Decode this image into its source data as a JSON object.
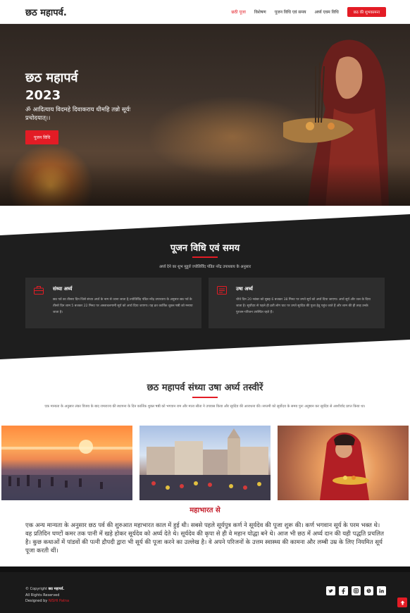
{
  "header": {
    "logo": "छठ महापर्व.",
    "nav": [
      "छठी पूजा",
      "विशेषण",
      "पूजन विधि एवं समय",
      "अर्घ्य एवम विधि"
    ],
    "cta": "छठ की शुभकामना"
  },
  "hero": {
    "title_line1": "छठ महापर्व",
    "title_line2": "2023",
    "mantra": "ॐ आदित्याय विदमहे दिवाकराय धीमहि तन्नो सूर्यः प्रचोदयात्।।",
    "button": "पूजन विधि"
  },
  "puja": {
    "title": "पूजन विधि एवं समय",
    "subtitle": "अर्घ्य देने का शुभ मुहूर्त ज्योतिर्विद पंडित नरेंद्र उपाध्याय के अनुसार",
    "cards": [
      {
        "title": "संध्या अर्घ्य",
        "text": "छठ पर्व का तीसरा दिन जिसे संध्या अर्घ्य के नाम से जाना जाता है,ज्योतिर्विद पंडित नरेंद्र उपाध्याय के अनुसार छठ पर्व के तीसरे दिन शाम 5 बजकर 22 मिनट पर अस्ताचलगामी सूर्य को अर्घ्य दिया जाएगा। यह व्रत कार्तिक शुक्ल षष्ठी को मनाया जाता है।"
      },
      {
        "title": "उषा अर्घ्य",
        "text": "चौथे दिन 20 नवंबर को सुबह 6 बजकर 38 मिनट पर उगते सूर्य को अर्घ्य दिया जाएगा। अर्घ्य सूर्य और जल के दिया जाता है। सूर्योदय से पहले ही व्रती लोग घाट पर उगते सूर्यदेव की पूजा हेतु पहुंच जाते हैं और शाम की ही तरह उनके पुरजन-परिजन उपस्थित रहते हैं।"
      }
    ]
  },
  "gallery": {
    "title": "छठ महापर्व संध्या उषा अर्घ्य तस्वीरें",
    "subtitle": "एक मान्यता के अनुसार लंका विजय के बाद रामराज्य की स्थापना के दिन कार्तिक शुक्ल षष्ठी को भगवान राम और माता सीता ने उपवास किया और सूर्यदेव की आराधना की। सप्तमी को सूर्योदय के समय पुनः अनुष्ठान कर सूर्यदेव से आशीर्वाद प्राप्त किया था।"
  },
  "mahabharat": {
    "title": "महाभारत से",
    "text": "एक अन्य मान्यता के अनुसार छठ पर्व की शुरुआत महाभारत काल में हुई थी। सबसे पहले सूर्यपुत्र कर्ण ने सूर्यदेव की पूजा शुरू की। कर्ण भगवान सूर्य के परम भक्त थे। वह प्रतिदिन घण्टों कमर तक पानी में खड़े होकर सूर्यदेव को अर्घ्य देते थे। सूर्यदेव की कृपा से ही वे महान योद्धा बने थे। आज भी छठ में अर्घ्य दान की यही पद्धति प्रचलित है। कुछ कथाओं में पांडवों की पत्नी द्रौपदी द्वारा भी सूर्य की पूजा करने का उल्लेख है। वे अपने परिजनों के उत्तम स्वास्थ्य की कामना और लम्बी उम्र के लिए नियमित सूर्य पूजा करती थीं।"
  },
  "footer": {
    "copyright_prefix": "© Copyright",
    "brand": "छठ महापर्व.",
    "rights": "All Rights Reserved",
    "designed_by": "Designed by",
    "designer": "NISHI Patna",
    "social_icons": [
      "twitter-icon",
      "facebook-icon",
      "instagram-icon",
      "skype-icon",
      "linkedin-icon"
    ]
  },
  "colors": {
    "accent": "#e31c25",
    "dark": "#1e1e1e",
    "card": "#2d2d2d"
  }
}
